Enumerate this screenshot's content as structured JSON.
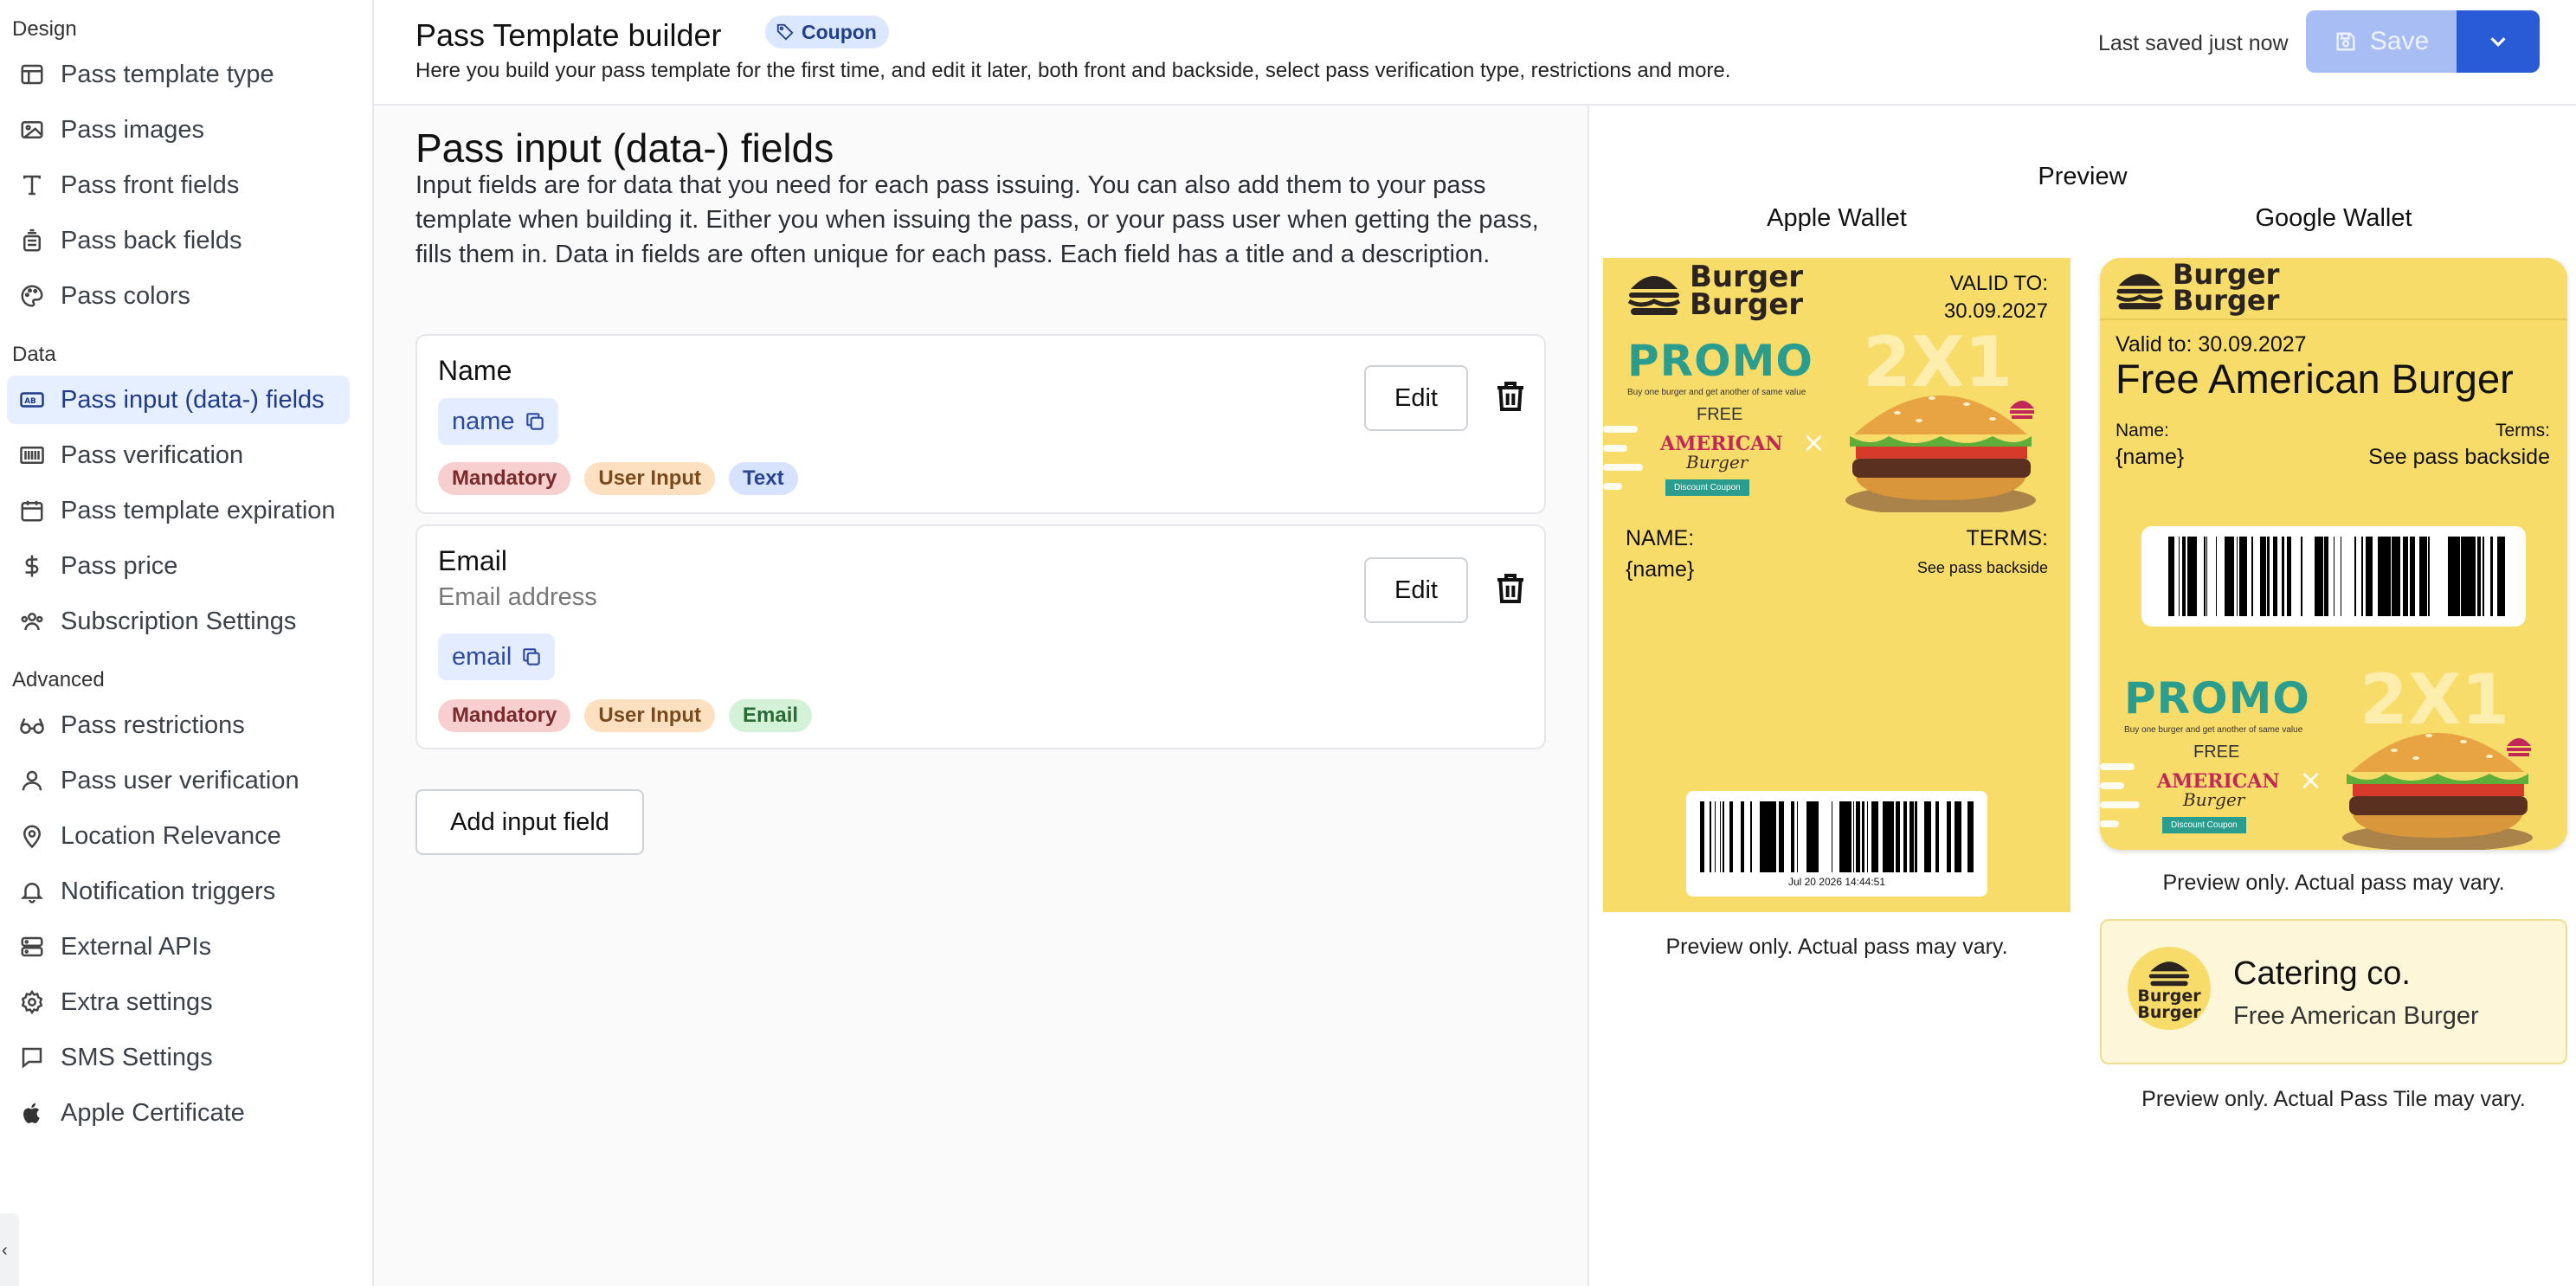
{
  "sidebar": {
    "sections": [
      {
        "label": "Design"
      },
      {
        "label": "Data"
      },
      {
        "label": "Advanced"
      }
    ],
    "items": [
      {
        "label": "Pass template type",
        "icon": "layout-icon"
      },
      {
        "label": "Pass images",
        "icon": "image-icon"
      },
      {
        "label": "Pass front fields",
        "icon": "text-icon"
      },
      {
        "label": "Pass back fields",
        "icon": "stack-icon"
      },
      {
        "label": "Pass colors",
        "icon": "palette-icon"
      },
      {
        "label": "Pass input (data-) fields",
        "icon": "input-field-icon",
        "active": true
      },
      {
        "label": "Pass verification",
        "icon": "barcode-icon"
      },
      {
        "label": "Pass template expiration",
        "icon": "calendar-icon"
      },
      {
        "label": "Pass price",
        "icon": "dollar-icon"
      },
      {
        "label": "Subscription Settings",
        "icon": "users-icon"
      },
      {
        "label": "Pass restrictions",
        "icon": "glasses-icon"
      },
      {
        "label": "Pass user verification",
        "icon": "user-icon"
      },
      {
        "label": "Location Relevance",
        "icon": "map-pin-icon"
      },
      {
        "label": "Notification triggers",
        "icon": "bell-icon"
      },
      {
        "label": "External APIs",
        "icon": "server-icon"
      },
      {
        "label": "Extra settings",
        "icon": "gear-icon"
      },
      {
        "label": "SMS Settings",
        "icon": "message-icon"
      },
      {
        "label": "Apple Certificate",
        "icon": "apple-icon"
      }
    ]
  },
  "header": {
    "title": "Pass Template builder",
    "badge": "Coupon",
    "subtitle": "Here you build your pass template for the first time, and edit it later, both front and backside, select pass verification type, restrictions and more.",
    "last_saved": "Last saved just now",
    "save_label": "Save",
    "colors": {
      "save_disabled": "#a9bdf5",
      "save_dropdown": "#2a5bd7"
    }
  },
  "main": {
    "title": "Pass input (data-) fields",
    "description": "Input fields are for data that you need for each pass issuing. You can also add them to your pass template when building it. Either you when issuing the pass, or your pass user when getting the pass, fills them in. Data in fields are often unique for each pass. Each field has a title and a description.",
    "fields": [
      {
        "title": "Name",
        "description": "",
        "key": "name",
        "tags": [
          "Mandatory",
          "User Input",
          "Text"
        ]
      },
      {
        "title": "Email",
        "description": "Email address",
        "key": "email",
        "tags": [
          "Mandatory",
          "User Input",
          "Email"
        ]
      }
    ],
    "edit_label": "Edit",
    "add_label": "Add input field"
  },
  "preview": {
    "title": "Preview",
    "apple": {
      "label": "Apple Wallet",
      "brand": [
        "Burger",
        "Burger"
      ],
      "valid_label": "VALID TO:",
      "valid_value": "30.09.2027",
      "name_label": "NAME:",
      "name_value": "{name}",
      "terms_label": "TERMS:",
      "terms_value": "See pass backside",
      "barcode_caption": "Jul 20 2026 14:44:51",
      "note": "Preview only. Actual pass may vary."
    },
    "google": {
      "label": "Google Wallet",
      "brand": [
        "Burger",
        "Burger"
      ],
      "valid_text": "Valid to: 30.09.2027",
      "headline": "Free American Burger",
      "name_label": "Name:",
      "name_value": "{name}",
      "terms_label": "Terms:",
      "terms_value": "See pass backside",
      "note": "Preview only. Actual pass may vary."
    },
    "promo": {
      "word": "PROMO",
      "tagline": "Buy one burger and get another of same value",
      "free": "FREE",
      "american": "AMERICAN",
      "burger_script": "Burger",
      "chip": "Discount Coupon",
      "deal": "2X1"
    },
    "tile": {
      "logo_text": [
        "Burger",
        "Burger"
      ],
      "name": "Catering co.",
      "desc": "Free American Burger",
      "note": "Preview only. Actual Pass Tile may vary."
    },
    "colors": {
      "pass_bg": "#f8dc6a",
      "promo_teal": "#2a9d8f",
      "promo_pink": "#c0285a"
    }
  }
}
